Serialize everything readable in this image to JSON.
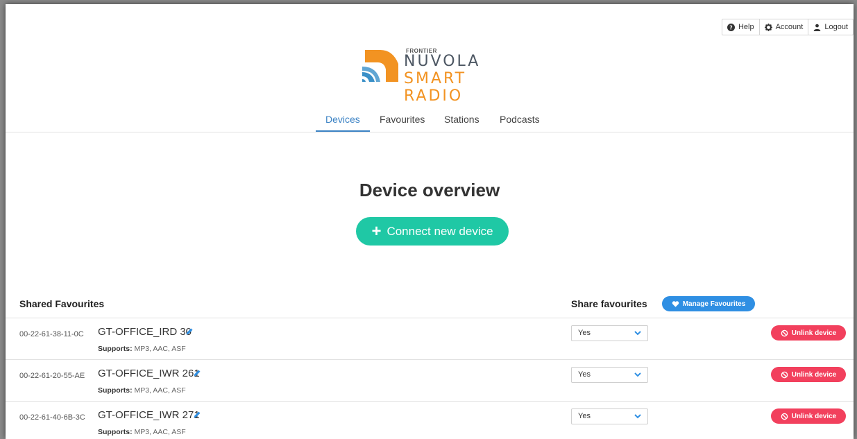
{
  "user_menu": [
    {
      "label": "Help",
      "icon": "question-circle-icon"
    },
    {
      "label": "Account",
      "icon": "gear-icon"
    },
    {
      "label": "Logout",
      "icon": "user-icon"
    }
  ],
  "logo": {
    "brand": "FRONTIER",
    "line1": "NUVOLA",
    "line2": "SMART RADIO",
    "colors": {
      "orange": "#f29322",
      "blue": "#3a90c8",
      "text": "#4d5763"
    }
  },
  "nav": {
    "tabs": [
      "Devices",
      "Favourites",
      "Stations",
      "Podcasts"
    ],
    "active": "Devices"
  },
  "page_title": "Device overview",
  "connect_button": "Connect new device",
  "table": {
    "header_left": "Shared Favourites",
    "header_share": "Share favourites",
    "manage_button": "Manage Favourites",
    "supports_label": "Supports:",
    "unlink_label": "Unlink device",
    "rows": [
      {
        "mac": "00-22-61-38-11-0C",
        "name": "GT-OFFICE_IRD 30",
        "supports": "MP3, AAC, ASF",
        "share": "Yes"
      },
      {
        "mac": "00-22-61-20-55-AE",
        "name": "GT-OFFICE_IWR 261",
        "supports": "MP3, AAC, ASF",
        "share": "Yes"
      },
      {
        "mac": "00-22-61-40-6B-3C",
        "name": "GT-OFFICE_IWR 271",
        "supports": "MP3, AAC, ASF",
        "share": "Yes"
      }
    ]
  },
  "colors": {
    "accent_blue": "#3b82c4",
    "connect_green": "#1fc8a5",
    "manage_blue": "#2f8fe3",
    "unlink_red": "#f2405d"
  }
}
